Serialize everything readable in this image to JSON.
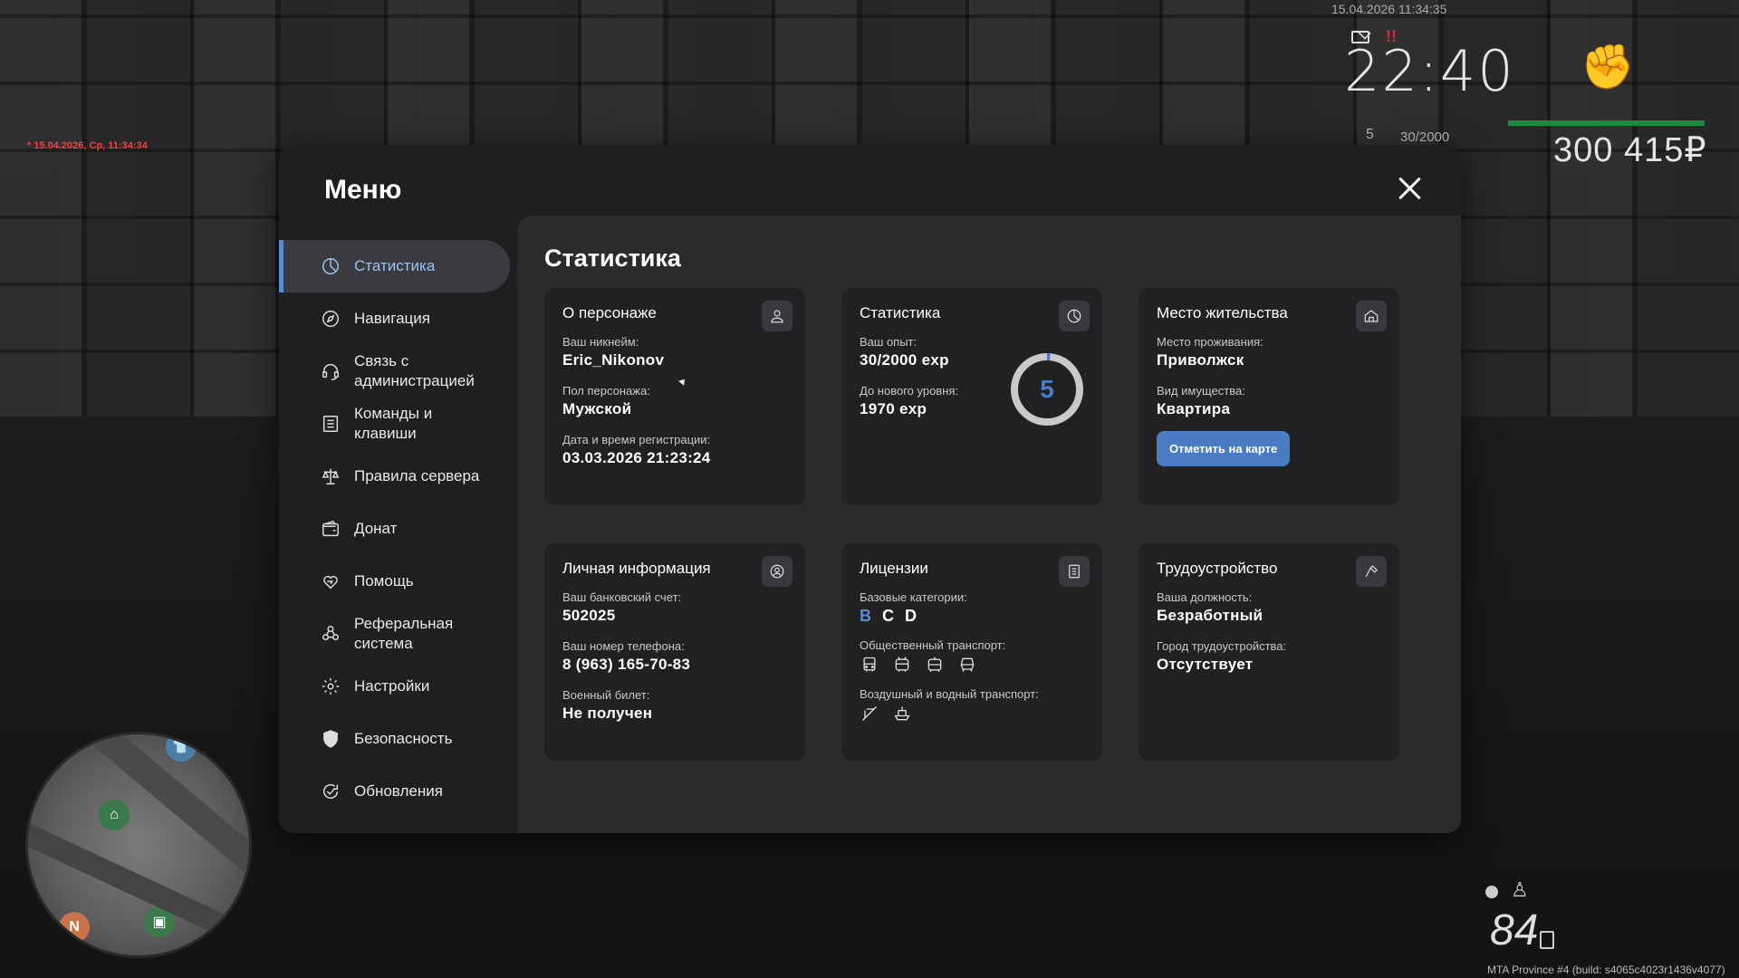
{
  "hud": {
    "top_datetime": "15.04.2026 11:34:35",
    "red_datetime": "* 15.04.2026, Ср, 11:34:34",
    "clock": "22:40",
    "alert": "!!",
    "level": "5",
    "exp": "30/2000",
    "money": "300 415₽",
    "speed": "84",
    "build": "MTA Province #4 (build: s4065c4023r1436v4077)"
  },
  "menu": {
    "title": "Меню",
    "sidebar": [
      {
        "label": "Статистика",
        "icon": "pie-chart-icon",
        "active": true
      },
      {
        "label": "Навигация",
        "icon": "compass-icon"
      },
      {
        "label": "Связь с администрацией",
        "icon": "headset-icon"
      },
      {
        "label": "Команды и клавиши",
        "icon": "list-icon"
      },
      {
        "label": "Правила сервера",
        "icon": "scales-icon"
      },
      {
        "label": "Донат",
        "icon": "wallet-icon"
      },
      {
        "label": "Помощь",
        "icon": "heart-hand-icon"
      },
      {
        "label": "Реферальная система",
        "icon": "people-icon"
      },
      {
        "label": "Настройки",
        "icon": "gear-icon"
      },
      {
        "label": "Безопасность",
        "icon": "shield-icon"
      },
      {
        "label": "Обновления",
        "icon": "refresh-check-icon"
      }
    ],
    "accent": "#5b8bd1"
  },
  "content": {
    "title": "Статистика",
    "character": {
      "title": "О персонаже",
      "nick_label": "Ваш никнейм:",
      "nick": "Eric_Nikonov",
      "gender_label": "Пол персонажа:",
      "gender": "Мужской",
      "reg_label": "Дата и время регистрации:",
      "reg": "03.03.2026 21:23:24"
    },
    "stats": {
      "title": "Статистика",
      "exp_label": "Ваш опыт:",
      "exp": "30/2000 exp",
      "next_label": "До нового уровня:",
      "next": "1970 exp",
      "level": "5",
      "progress": 0.015
    },
    "residence": {
      "title": "Место жительства",
      "place_label": "Место проживания:",
      "place": "Приволжск",
      "property_label": "Вид имущества:",
      "property": "Квартира",
      "button": "Отметить на карте"
    },
    "personal": {
      "title": "Личная информация",
      "bank_label": "Ваш банковский счет:",
      "bank": "502025",
      "phone_label": "Ваш номер телефона:",
      "phone": "8 (963) 165-70-83",
      "military_label": "Военный билет:",
      "military": "Не получен"
    },
    "licenses": {
      "title": "Лицензии",
      "base_label": "Базовые категории:",
      "cat_b": "B",
      "cat_c": "C",
      "cat_d": "D",
      "public_label": "Общественный транспорт:",
      "air_label": "Воздушный и водный транспорт:"
    },
    "employment": {
      "title": "Трудоустройство",
      "position_label": "Ваша должность:",
      "position": "Безработный",
      "city_label": "Город трудоустройства:",
      "city": "Отсутствует"
    }
  }
}
